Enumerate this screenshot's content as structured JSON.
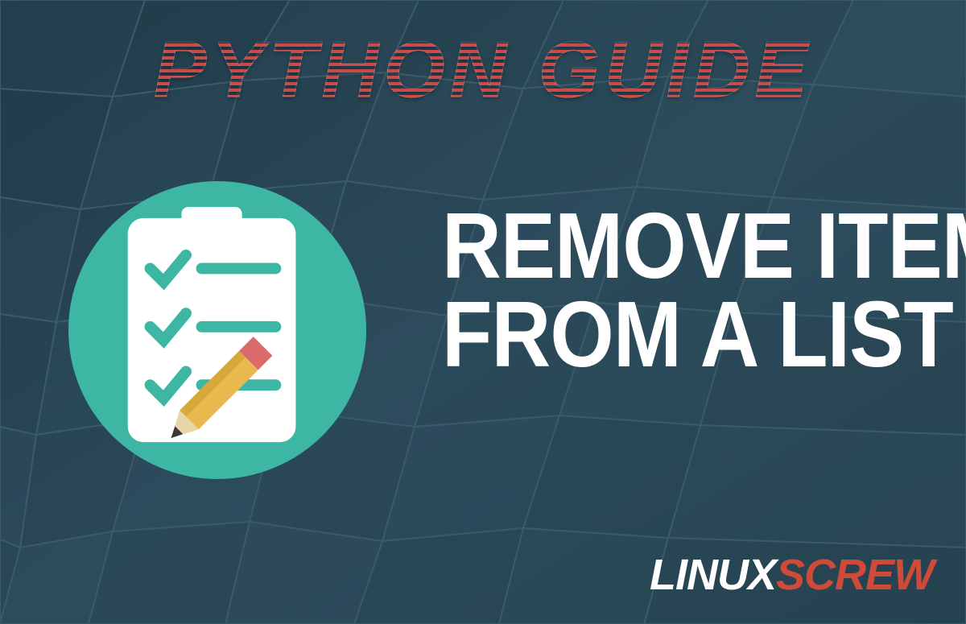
{
  "header": {
    "title": "PYTHON GUIDE"
  },
  "main": {
    "line1": "REMOVE ITEMS",
    "line2": "FROM A LIST"
  },
  "icon": {
    "name": "checklist-pencil-icon"
  },
  "watermark": {
    "part1": "LINUX",
    "part2": "SCREW"
  },
  "colors": {
    "bg": "#2a4958",
    "accent_circle": "#3db7a3",
    "header_text": "#c94a4a",
    "main_text": "#ffffff",
    "brand_red": "#cf4a39"
  }
}
